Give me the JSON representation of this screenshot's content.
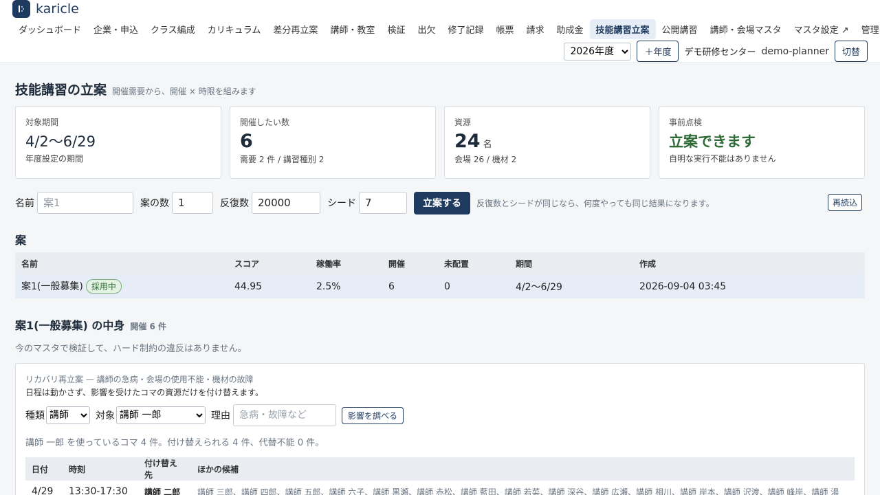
{
  "brand": {
    "name": "karicle"
  },
  "nav": [
    {
      "label": "ダッシュボード",
      "active": false
    },
    {
      "label": "企業・申込",
      "active": false
    },
    {
      "label": "クラス編成",
      "active": false
    },
    {
      "label": "カリキュラム",
      "active": false
    },
    {
      "label": "差分再立案",
      "active": false
    },
    {
      "label": "講師・教室",
      "active": false
    },
    {
      "label": "検証",
      "active": false
    },
    {
      "label": "出欠",
      "active": false
    },
    {
      "label": "修了記録",
      "active": false
    },
    {
      "label": "帳票",
      "active": false
    },
    {
      "label": "請求",
      "active": false
    },
    {
      "label": "助成金",
      "active": false
    },
    {
      "label": "技能講習立案",
      "active": true
    },
    {
      "label": "公開講習",
      "active": false
    },
    {
      "label": "講師・会場マスタ",
      "active": false
    },
    {
      "label": "マスタ設定 ↗",
      "active": false
    },
    {
      "label": "管理",
      "active": false
    }
  ],
  "header": {
    "year_value": "2026年度",
    "add_year_label": "＋年度",
    "org": "デモ研修センター",
    "user": "demo-planner",
    "switch_label": "切替"
  },
  "page": {
    "title": "技能講習の立案",
    "subtitle": "開催需要から、開催 × 時限を組みます"
  },
  "cards": {
    "period": {
      "label": "対象期間",
      "value": "4/2〜6/29",
      "note": "年度設定の期間"
    },
    "target": {
      "label": "開催したい数",
      "value": "6",
      "note": "需要 2 件 / 講習種別 2"
    },
    "resources": {
      "label": "資源",
      "value": "24",
      "unit": "名",
      "note": "会場 26 / 機材 2"
    },
    "precheck": {
      "label": "事前点検",
      "value": "立案できます",
      "note": "自明な実行不能はありません"
    }
  },
  "form": {
    "name_label": "名前",
    "name_placeholder": "案1",
    "count_label": "案の数",
    "count_value": "1",
    "iter_label": "反復数",
    "iter_value": "20000",
    "seed_label": "シード",
    "seed_value": "7",
    "submit_label": "立案する",
    "hint": "反復数とシードが同じなら、何度やっても同じ結果になります。",
    "reload_label": "再読込"
  },
  "plans": {
    "heading": "案",
    "columns": [
      "名前",
      "スコア",
      "稼働率",
      "開催",
      "未配置",
      "期間",
      "作成"
    ],
    "rows": [
      {
        "name": "案1(一般募集)",
        "badge": "採用中",
        "score": "44.95",
        "util": "2.5%",
        "held": "6",
        "unassigned": "0",
        "period": "4/2〜6/29",
        "created": "2026-09-04 03:45"
      }
    ]
  },
  "detail": {
    "title": "案1(一般募集) の中身",
    "count": "開催 6 件",
    "validation": "今のマスタで検証して、ハード制約の違反はありません。"
  },
  "recovery": {
    "title": "リカバリ再立案 — 講師の急病・会場の使用不能・機材の故障",
    "desc": "日程は動かさず、影響を受けたコマの資源だけを付け替えます。",
    "type_label": "種類",
    "type_value": "講師",
    "target_label": "対象",
    "target_value": "講師 一郎",
    "reason_label": "理由",
    "reason_placeholder": "急病・故障など",
    "check_label": "影響を調べる",
    "summary": "講師 一郎 を使っているコマ 4 件。付け替えられる 4 件、代替不能 0 件。",
    "columns": [
      "日付",
      "時刻",
      "付け替え先",
      "ほかの候補"
    ],
    "rows": [
      {
        "date": "4/29",
        "time": "13:30-17:30",
        "assign": "講師 二郎",
        "candidates": "講師 三郎、講師 四郎、講師 五郎、講師 六子、講師 黒瀬、講師 赤松、講師 藍田、講師 若菜、講師 深谷、講師 広瀬、講師 相川、講師 岸本、講師 沢渡、講師 峰岸、講師 湯"
      }
    ]
  }
}
